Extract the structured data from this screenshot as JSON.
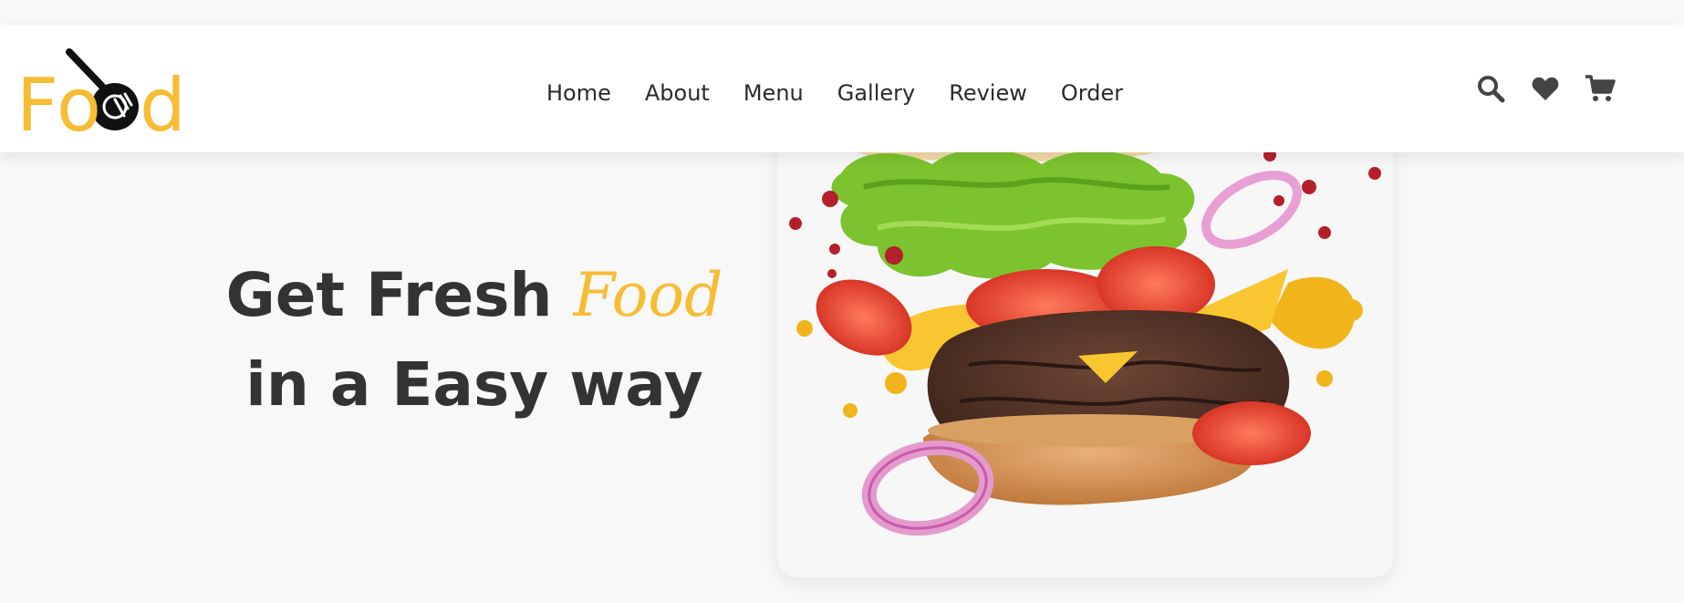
{
  "brand": {
    "logo_text": "Food",
    "logo_color": "#f6bc33",
    "logo_icon": "spoon-fork-icon"
  },
  "nav": {
    "items": [
      {
        "label": "Home"
      },
      {
        "label": "About"
      },
      {
        "label": "Menu"
      },
      {
        "label": "Gallery"
      },
      {
        "label": "Review"
      },
      {
        "label": "Order"
      }
    ]
  },
  "header_icons": [
    {
      "name": "search-icon"
    },
    {
      "name": "heart-icon"
    },
    {
      "name": "cart-icon"
    }
  ],
  "hero": {
    "line1_prefix": "Get Fresh ",
    "line1_accent": "Food",
    "line2": "in a Easy way",
    "accent_color": "#f6bc33",
    "text_color": "#333333",
    "image": "flying-burger-image"
  }
}
